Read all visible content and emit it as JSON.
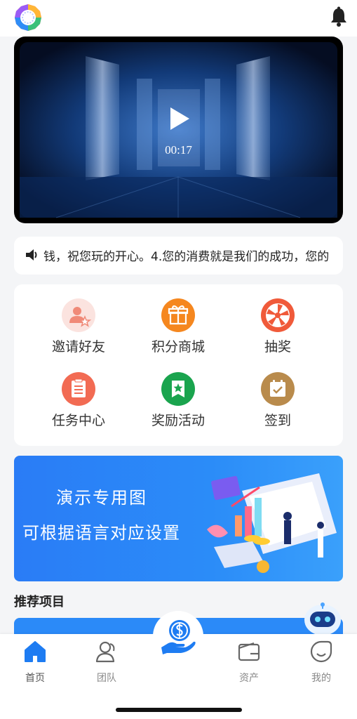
{
  "video": {
    "time": "00:17"
  },
  "notice": {
    "text": "钱，祝您玩的开心。4.您的消费就是我们的成功，您的"
  },
  "menu": [
    {
      "label": "邀请好友",
      "icon": "invite-friend-icon",
      "color": "#fbe3df"
    },
    {
      "label": "积分商城",
      "icon": "gift-icon",
      "color": "#f5871f"
    },
    {
      "label": "抽奖",
      "icon": "lottery-wheel-icon",
      "color": "#f05a3a"
    },
    {
      "label": "任务中心",
      "icon": "task-list-icon",
      "color": "#f26b53"
    },
    {
      "label": "奖励活动",
      "icon": "reward-badge-icon",
      "color": "#1aa44e"
    },
    {
      "label": "签到",
      "icon": "checkin-calendar-icon",
      "color": "#b98b4c"
    }
  ],
  "banner": {
    "line1": "演示专用图",
    "line2": "可根据语言对应设置"
  },
  "section": {
    "title": "推荐项目"
  },
  "tabs": [
    {
      "label": "首页",
      "icon": "home-icon"
    },
    {
      "label": "团队",
      "icon": "team-icon"
    },
    {
      "label": "",
      "icon": "money-hand-icon"
    },
    {
      "label": "资产",
      "icon": "wallet-icon"
    },
    {
      "label": "我的",
      "icon": "profile-icon"
    }
  ],
  "colors": {
    "accent": "#1e7cf2",
    "tab_inactive": "#888888"
  }
}
